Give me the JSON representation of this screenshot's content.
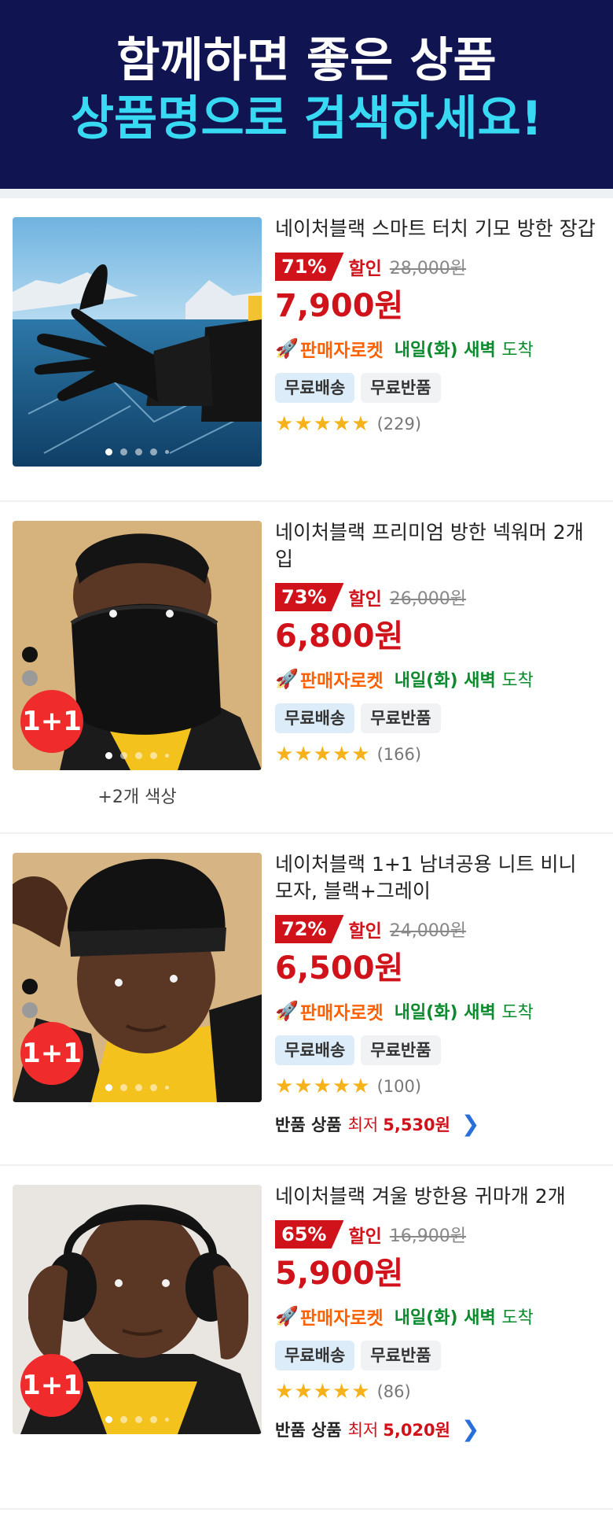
{
  "banner": {
    "line1": "함께하면 좋은 상품",
    "line2": "상품명으로 검색하세요!"
  },
  "common": {
    "discount_label": "할인",
    "rocket_label": "판매자로켓",
    "arrival_day": "내일(화)",
    "arrival_time": "새벽",
    "arrival_word": "도착",
    "chip_free_shipping": "무료배송",
    "chip_free_return": "무료반품",
    "return_label": "반품 상품",
    "lowest_label": "최저",
    "star_glyph": "★",
    "one_plus_one": "1+1"
  },
  "products": [
    {
      "title": "네이처블랙 스마트 터치 기모 방한 장갑",
      "discount": "71%",
      "original_price": "28,000원",
      "price": "7,900원",
      "rating": 5,
      "review_count": "(229)",
      "image_subject": "black touchscreen glove over frozen lake"
    },
    {
      "title": "네이처블랙 프리미엄 방한 넥워머 2개입",
      "discount": "73%",
      "original_price": "26,000원",
      "price": "6,800원",
      "rating": 5,
      "review_count": "(166)",
      "more_colors": "+2개 색상",
      "image_subject": "man wearing black neck warmer"
    },
    {
      "title": "네이처블랙 1+1 남녀공용 니트 비니 모자, 블랙+그레이",
      "discount": "72%",
      "original_price": "24,000원",
      "price": "6,500원",
      "rating": 5,
      "review_count": "(100)",
      "return_price": "5,530원",
      "image_subject": "man wearing black knit beanie"
    },
    {
      "title": "네이처블랙 겨울 방한용 귀마개 2개",
      "discount": "65%",
      "original_price": "16,900원",
      "price": "5,900원",
      "rating": 5,
      "review_count": "(86)",
      "return_price": "5,020원",
      "image_subject": "man wearing black ear muffs"
    }
  ],
  "colors": {
    "banner_bg": "#101451",
    "banner_accent": "#38d9f2",
    "price_red": "#d0121b",
    "rocket_orange": "#ff6000",
    "arrival_green": "#0b8b2d",
    "star_yellow": "#f6b21a"
  }
}
